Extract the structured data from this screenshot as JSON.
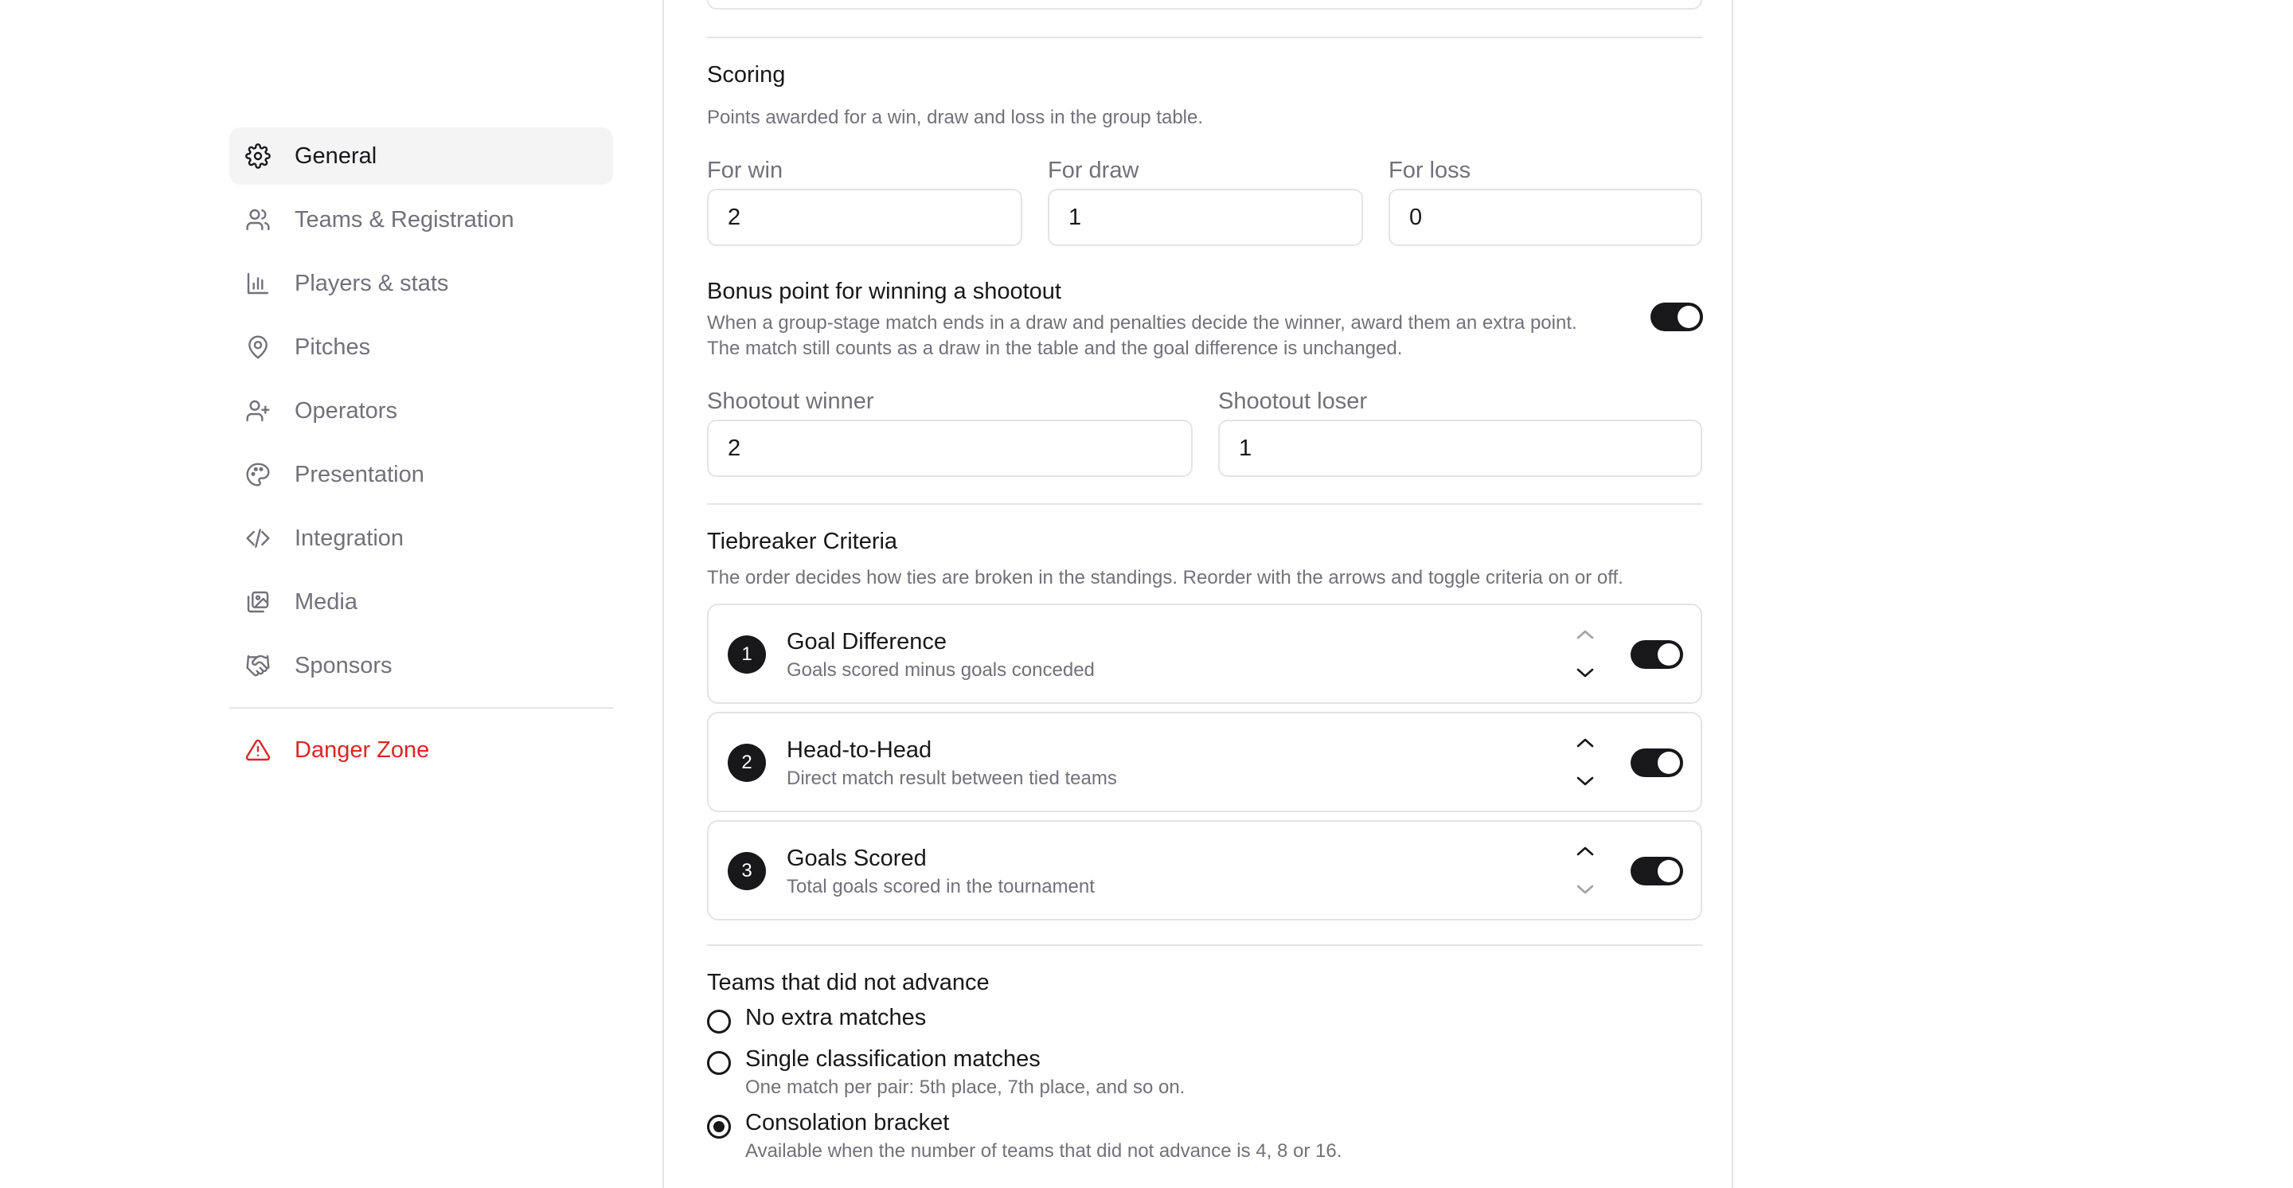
{
  "sidebar": {
    "items": [
      {
        "label": "General",
        "icon": "gear-icon",
        "active": true
      },
      {
        "label": "Teams & Registration",
        "icon": "users-icon"
      },
      {
        "label": "Players & stats",
        "icon": "bar-chart-icon"
      },
      {
        "label": "Pitches",
        "icon": "map-pin-icon"
      },
      {
        "label": "Operators",
        "icon": "user-plus-icon"
      },
      {
        "label": "Presentation",
        "icon": "palette-icon"
      },
      {
        "label": "Integration",
        "icon": "code-icon"
      },
      {
        "label": "Media",
        "icon": "images-icon"
      },
      {
        "label": "Sponsors",
        "icon": "handshake-icon"
      }
    ],
    "danger": {
      "label": "Danger Zone",
      "icon": "warning-icon",
      "color": "#dc2626"
    }
  },
  "scoring": {
    "title": "Scoring",
    "description": "Points awarded for a win, draw and loss in the group table.",
    "win": {
      "label": "For win",
      "value": "2"
    },
    "draw": {
      "label": "For draw",
      "value": "1"
    },
    "loss": {
      "label": "For loss",
      "value": "0"
    }
  },
  "bonus": {
    "title": "Bonus point for winning a shootout",
    "description": "When a group-stage match ends in a draw and penalties decide the winner, award them an extra point. The match still counts as a draw in the table and the goal difference is unchanged.",
    "enabled": true,
    "winner": {
      "label": "Shootout winner",
      "value": "2"
    },
    "loser": {
      "label": "Shootout loser",
      "value": "1"
    }
  },
  "tiebreaker": {
    "title": "Tiebreaker Criteria",
    "description": "The order decides how ties are broken in the standings. Reorder with the arrows and toggle criteria on or off.",
    "criteria": [
      {
        "rank": "1",
        "name": "Goal Difference",
        "description": "Goals scored minus goals conceded",
        "enabled": true
      },
      {
        "rank": "2",
        "name": "Head-to-Head",
        "description": "Direct match result between tied teams",
        "enabled": true
      },
      {
        "rank": "3",
        "name": "Goals Scored",
        "description": "Total goals scored in the tournament",
        "enabled": true
      }
    ]
  },
  "non_advancing": {
    "title": "Teams that did not advance",
    "options": [
      {
        "label": "No extra matches",
        "description": "",
        "selected": false
      },
      {
        "label": "Single classification matches",
        "description": "One match per pair: 5th place, 7th place, and so on.",
        "selected": false
      },
      {
        "label": "Consolation bracket",
        "description": "Available when the number of teams that did not advance is 4, 8 or 16.",
        "selected": true
      }
    ]
  },
  "colors": {
    "accent": "#18181b",
    "muted": "#71717a",
    "border": "#e4e4e7",
    "danger": "#dc2626",
    "active_bg": "#f4f4f5"
  }
}
